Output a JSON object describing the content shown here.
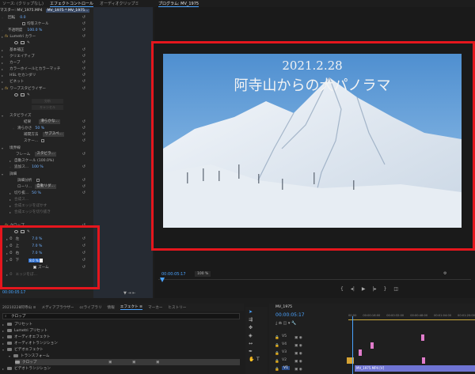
{
  "left_tabs": [
    "ソース: (クリップなし)",
    "エフェクトコントロール",
    "オーディオクリップミ"
  ],
  "left_tab_active": 1,
  "program_title": "プログラム: MV_1975",
  "ec": {
    "clip_header": "マスター: MV_1975.MP4",
    "clip_tab": "MV_1975 * MV_1975...",
    "rows": [
      {
        "label": "回転",
        "value": "0.0"
      },
      {
        "label": "",
        "value": "",
        "extra": "均等スケール"
      },
      {
        "label": "不透明度",
        "value": "100.0 %"
      },
      {
        "label": "Lumetri カラー"
      },
      {
        "label": "基本補正"
      },
      {
        "label": "クリエイティブ"
      },
      {
        "label": "カーブ"
      },
      {
        "label": "カラーホイールとカラーマッチ"
      },
      {
        "label": "HSL セカンダリ"
      },
      {
        "label": "ビネット"
      },
      {
        "label": "ワープスタビライザー"
      },
      {
        "label": "分析"
      },
      {
        "label": "キャンセル"
      },
      {
        "label": "スタビライズ"
      },
      {
        "label": "結果",
        "dd": "滑らかな..."
      },
      {
        "label": "滑らかさ",
        "value": "50 %"
      },
      {
        "label": "補間方法",
        "dd": "サブスペ..."
      },
      {
        "label": "スケー..."
      },
      {
        "label": "境界線"
      },
      {
        "label": "フレーム",
        "dd": "スタビラ..."
      },
      {
        "label": "自動スケール (100.0%)"
      },
      {
        "label": "追加ス...",
        "value": "100 %"
      },
      {
        "label": "詳細"
      },
      {
        "label": "詳細分析"
      },
      {
        "label": "ローリ...",
        "dd": "自動リダ..."
      },
      {
        "label": "切り抜...",
        "value": "50 %"
      },
      {
        "label": "合成ス..."
      },
      {
        "label": "合成エッジをぼかす"
      },
      {
        "label": "合成エッジを切り抜き"
      },
      {
        "label": "クロップ"
      },
      {
        "label": "左",
        "value": "7.0 %"
      },
      {
        "label": "上",
        "value": "7.0 %"
      },
      {
        "label": "右",
        "value": "7.0 %"
      },
      {
        "label": "下",
        "value": "8.0 %"
      },
      {
        "label": "ズーム"
      },
      {
        "label": "エッジをぼ..."
      }
    ],
    "timecode": "00:00:05:17"
  },
  "video": {
    "date_text": "2021.2.28",
    "title_text": "阿寺山からの大パノラマ"
  },
  "pm": {
    "timecode": "00:00:05:17",
    "zoom": "100 %"
  },
  "bottom_tabs": [
    "20210228阿寺山 ≡",
    "メディアブラウザー",
    "ccライブラリ",
    "情報",
    "エフェクト ≡",
    "マーカー",
    "ヒストリー"
  ],
  "search_value": "クロップ",
  "tree": [
    "プリセット",
    "Lumetri プリセット",
    "オーディオエフェクト",
    "オーディオトランジション",
    "ビデオエフェクト",
    "トランスフォーム",
    "クロップ",
    "ビデオトランジション"
  ],
  "timeline": {
    "sequence_name": "MV_1975",
    "timecode": "00:00:05:17",
    "ruler": [
      "00:00",
      "00:00:16:00",
      "00:00:32:00",
      "00:00:48:00",
      "00:01:04:00",
      "00:01:20:00"
    ],
    "tracks": [
      "V5",
      "V4",
      "V3",
      "V2",
      "V1"
    ],
    "clip_name": "MV_1975.MP4 [V]"
  },
  "colors": {
    "highlight": "#e5161d",
    "accent": "#4aa3ff",
    "clip_pink": "#e17ccb",
    "clip_blue": "#6f74d3"
  }
}
